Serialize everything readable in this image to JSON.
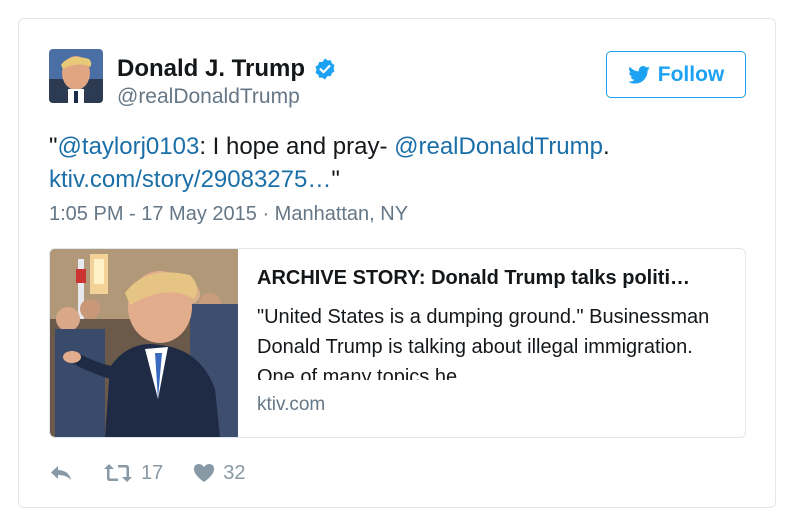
{
  "author": {
    "name": "Donald J. Trump",
    "handle": "@realDonaldTrump"
  },
  "follow_button": {
    "label": "Follow"
  },
  "tweet": {
    "open_quote": "\"",
    "mention_1": "@taylorj0103",
    "text_1": ": I hope and pray- ",
    "mention_2": "@realDonaldTrump",
    "text_2": ".",
    "link": "ktiv.com/story/29083275…",
    "close_quote": "\"",
    "timestamp": "1:05 PM - 17 May 2015 · Manhattan, NY"
  },
  "link_card": {
    "title": "ARCHIVE STORY: Donald Trump talks politi…",
    "description": "\"United States is a dumping ground.\" Businessman Donald Trump is talking about illegal immigration. One of many topics he",
    "domain": "ktiv.com"
  },
  "actions": {
    "retweet_count": "17",
    "like_count": "32"
  },
  "colors": {
    "link": "#1b6fa8",
    "follow_blue": "#1da1f2",
    "verified_blue": "#1da1f2",
    "muted": "#657786",
    "icon_gray": "#8899a6"
  }
}
